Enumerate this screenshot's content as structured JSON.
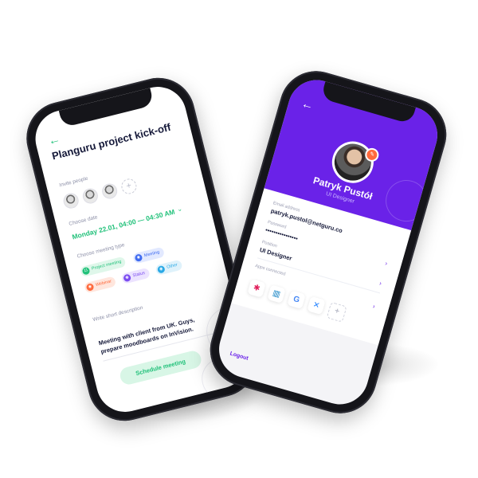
{
  "left_phone": {
    "back_icon": "arrow-left-icon",
    "title": "Planguru project kick-off",
    "invite_label": "Invite people",
    "add_icon": "plus-icon",
    "date_label": "Choose date",
    "date_value": "Monday 22.01, 04:00 — 04:30 AM",
    "date_chevron": "chevron-down-icon",
    "meeting_type_label": "Choose meeting type",
    "meeting_types": [
      {
        "label": "Project meeting",
        "color": "#21c17a",
        "bg": "#dff7ea",
        "glyph": "11"
      },
      {
        "label": "Meeting",
        "color": "#3f6bf0",
        "bg": "#e2e9ff",
        "glyph": "◉"
      },
      {
        "label": "Webinar",
        "color": "#ff6a3d",
        "bg": "#ffe6dd",
        "glyph": "◉"
      },
      {
        "label": "Status",
        "color": "#7b4cf0",
        "bg": "#ece3ff",
        "glyph": "◉"
      },
      {
        "label": "Other",
        "color": "#2aa9e6",
        "bg": "#dff2fb",
        "glyph": "◉"
      }
    ],
    "description_label": "Write short description",
    "description": "Meeting with client from UK. Guys, prepare moodboards on InVision.",
    "schedule_button": "Schedule meeting"
  },
  "right_phone": {
    "back_icon": "arrow-left-icon",
    "name": "Patryk Pustół",
    "role": "UI Designer",
    "email_label": "Email address",
    "email_value": "patryk.pustol@netguru.co",
    "password_label": "Password",
    "password_value": "••••••••••••••••",
    "position_label": "Position",
    "position_value": "UI Designer",
    "apps_label": "Apps connected",
    "apps": [
      {
        "name": "slack-icon",
        "glyph": "✱",
        "color": "#e01e5a"
      },
      {
        "name": "trello-icon",
        "glyph": "▥",
        "color": "#0079bf"
      },
      {
        "name": "google-icon",
        "glyph": "G",
        "color": "#4285f4"
      },
      {
        "name": "jira-icon",
        "glyph": "✕",
        "color": "#2684ff"
      }
    ],
    "add_app_icon": "plus-icon",
    "logout": "Logout",
    "colors": {
      "accent": "#6a22e8"
    }
  }
}
